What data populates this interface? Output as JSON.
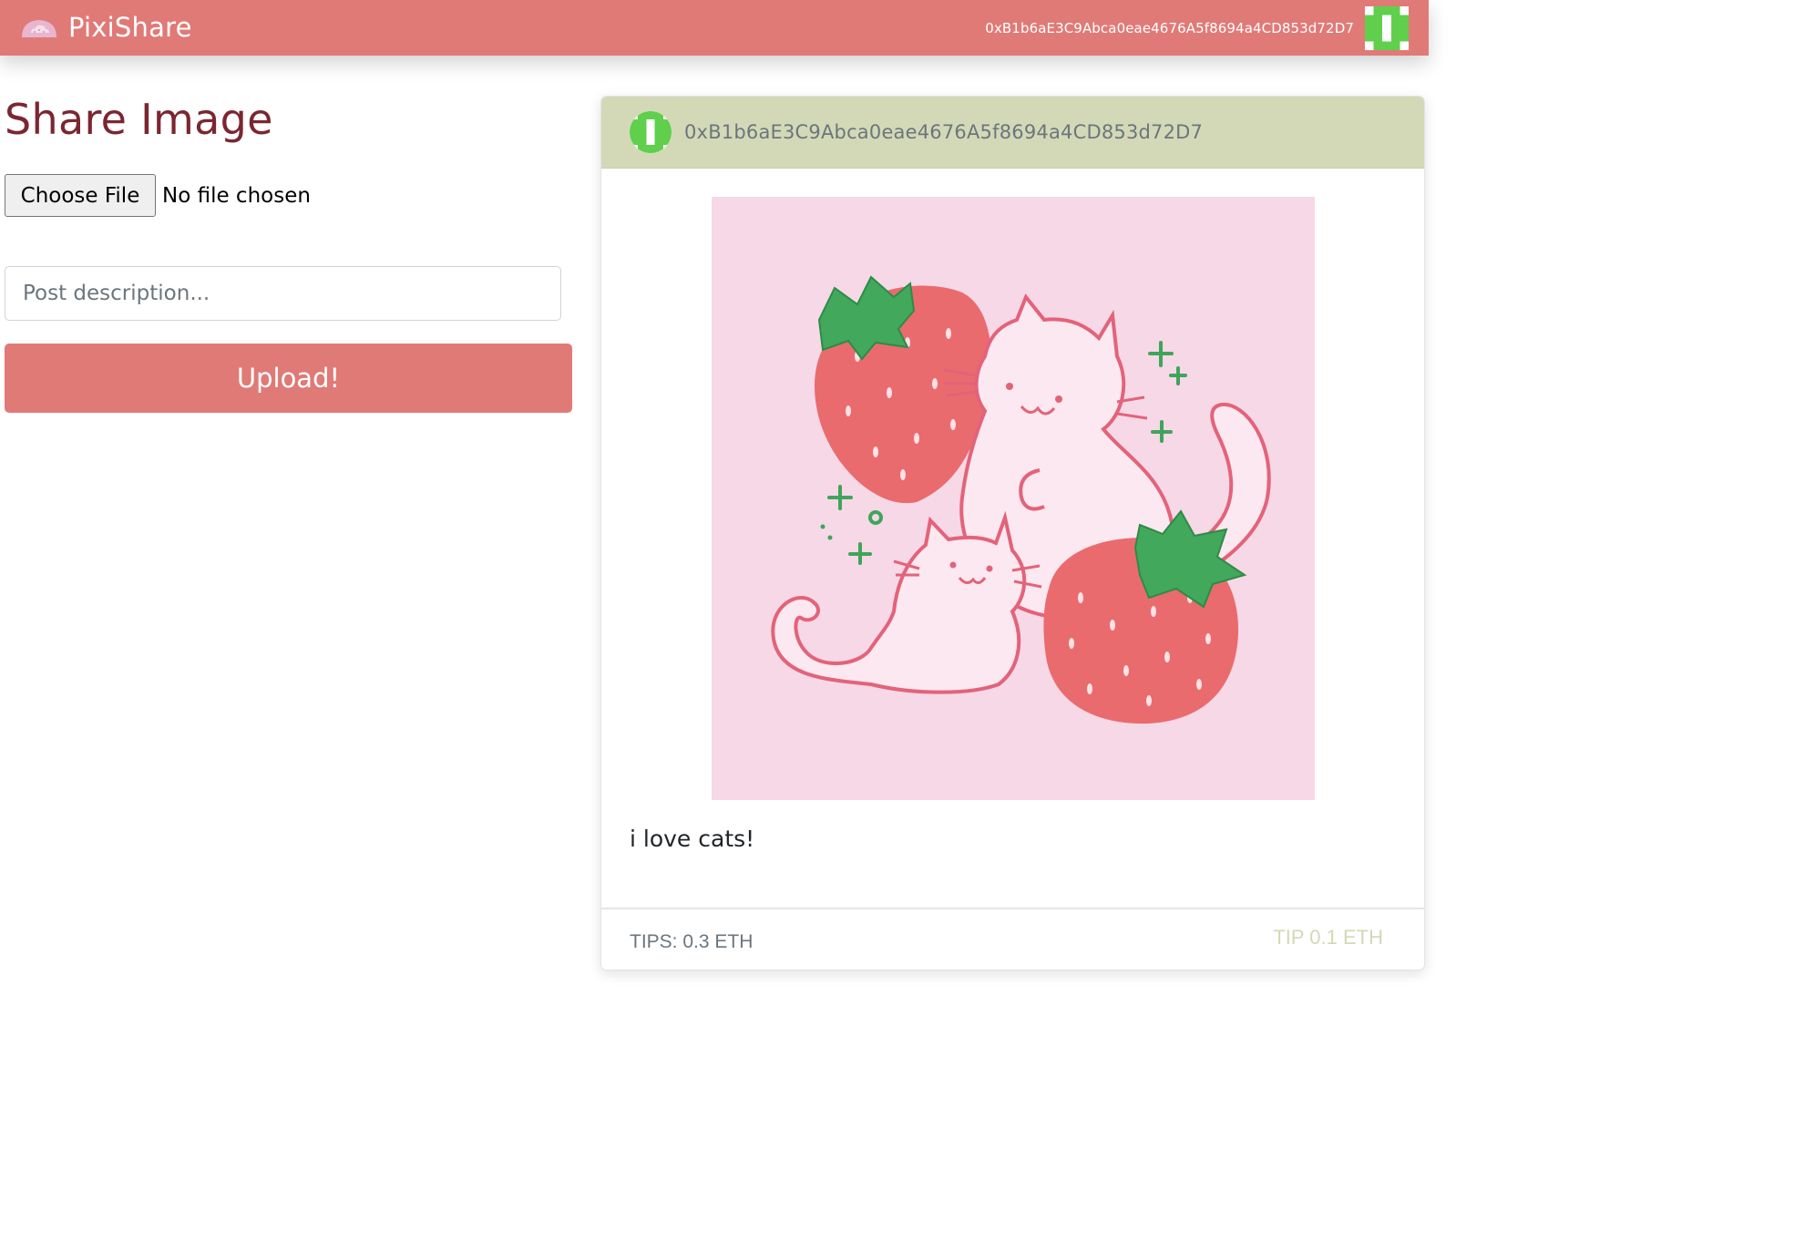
{
  "navbar": {
    "brand_name": "PixiShare",
    "brand_icon": "cloud-logo-icon",
    "account_address": "0xB1b6aE3C9Abca0eae4676A5f8694a4CD853d72D7",
    "avatar_icon": "identicon-avatar"
  },
  "share_form": {
    "title": "Share Image",
    "choose_file_label": "Choose File",
    "file_status": "No file chosen",
    "description_value": "",
    "description_placeholder": "Post description...",
    "upload_label": "Upload!"
  },
  "post": {
    "author": "0xB1b6aE3C9Abca0eae4676A5f8694a4CD853d72D7",
    "avatar_icon": "identicon-avatar",
    "image": "strawberry-cats-illustration",
    "description": "i love cats!",
    "tips_label": "TIPS: 0.3 ETH",
    "tip_button_label": "TIP 0.1 ETH"
  },
  "colors": {
    "primary": "#e07a77",
    "title": "#7b2631",
    "card_header": "#d3d9b7",
    "identicon_green": "#5fcf4c",
    "strawberry_red": "#e8636b",
    "leaf_green": "#3fa55a",
    "image_background": "#f7dbe8"
  }
}
